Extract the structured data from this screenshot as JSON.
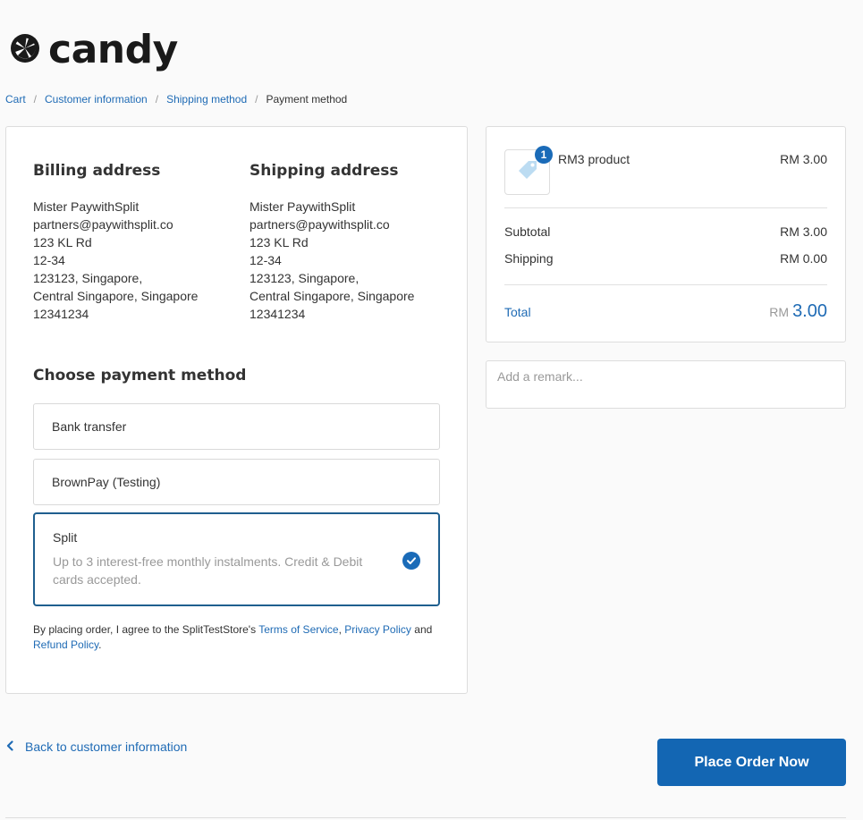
{
  "brand": {
    "name": "candy"
  },
  "breadcrumb": {
    "items": [
      "Cart",
      "Customer information",
      "Shipping method"
    ],
    "current": "Payment method",
    "separator": "/"
  },
  "billing": {
    "title": "Billing address",
    "lines": [
      "Mister PaywithSplit",
      "partners@paywithsplit.co",
      "123 KL Rd",
      "12-34",
      "123123, Singapore,",
      "Central Singapore, Singapore",
      "12341234"
    ]
  },
  "shipping": {
    "title": "Shipping address",
    "lines": [
      "Mister PaywithSplit",
      "partners@paywithsplit.co",
      "123 KL Rd",
      "12-34",
      "123123, Singapore,",
      "Central Singapore, Singapore",
      "12341234"
    ]
  },
  "payment": {
    "title": "Choose payment method",
    "options": [
      {
        "label": "Bank transfer"
      },
      {
        "label": "BrownPay (Testing)"
      },
      {
        "label": "Split",
        "description": "Up to 3 interest-free monthly instalments. Credit & Debit cards accepted.",
        "selected": true
      }
    ]
  },
  "terms": {
    "prefix": "By placing order, I agree to the SplitTestStore's ",
    "tos": "Terms of Service",
    "comma": ", ",
    "privacy": "Privacy Policy",
    "and": " and ",
    "refund": "Refund Policy",
    "suffix": "."
  },
  "summary": {
    "product": {
      "name": "RM3 product",
      "price": "RM 3.00",
      "quantity": "1"
    },
    "subtotal_label": "Subtotal",
    "subtotal_value": "RM 3.00",
    "shipping_label": "Shipping",
    "shipping_value": "RM 0.00",
    "total_label": "Total",
    "total_currency": "RM",
    "total_amount": "3.00"
  },
  "remark": {
    "placeholder": "Add a remark..."
  },
  "actions": {
    "back_label": "Back to customer information",
    "place_order_label": "Place Order Now"
  },
  "colors": {
    "accent": "#1366b3",
    "link": "#1f6bb5",
    "selected_border": "#1f5f8f"
  },
  "icons": {
    "logo": "orange-slice-icon",
    "product": "tag-icon",
    "selected": "check-circle-icon",
    "back": "chevron-left-icon"
  }
}
